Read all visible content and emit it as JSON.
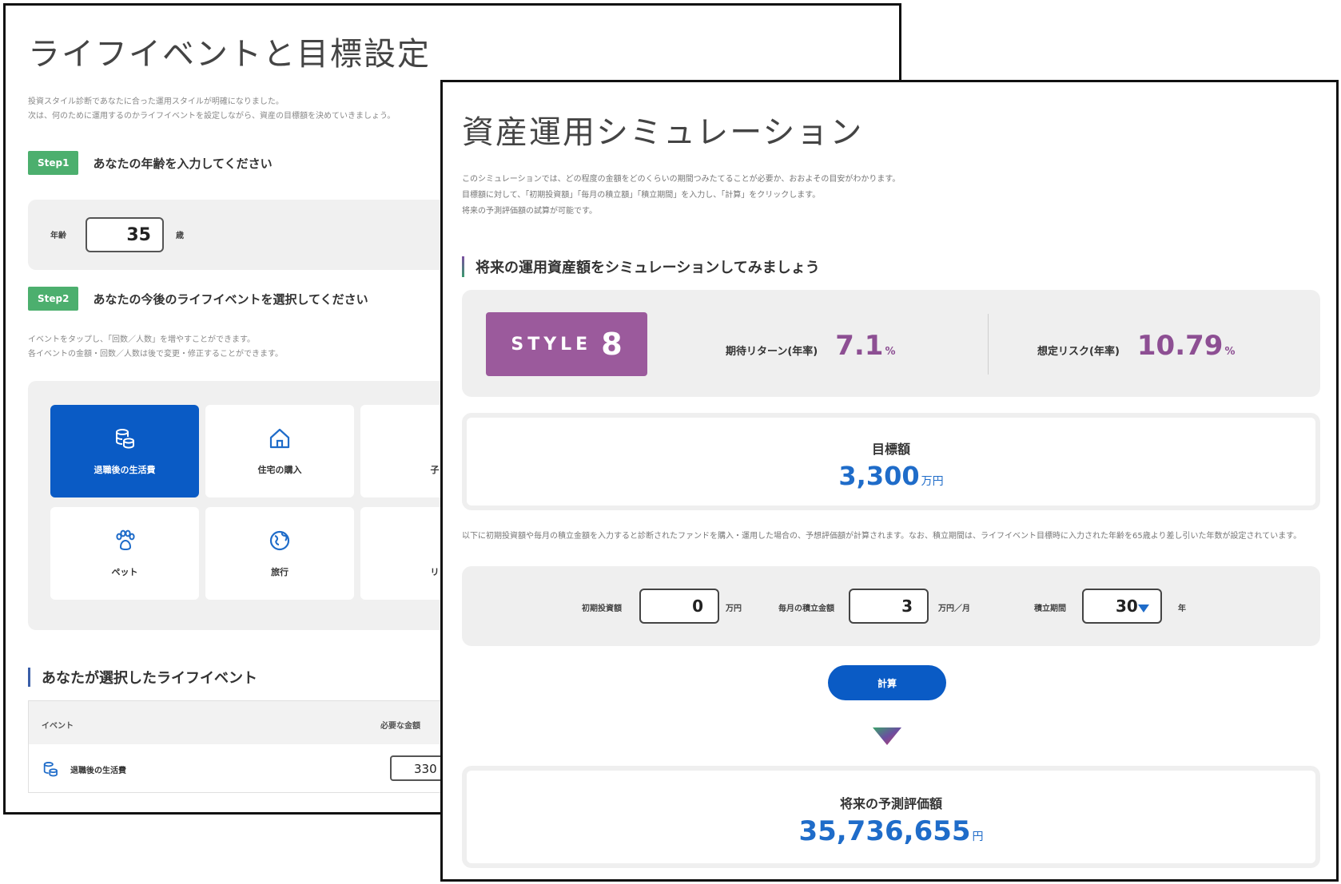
{
  "back": {
    "title": "ライフイベントと目標設定",
    "intro_lines": [
      "投資スタイル診断であなたに合った運用スタイルが明確になりました。",
      "次は、何のために運用するのかライフイベントを設定しながら、資産の目標額を決めていきましょう。"
    ],
    "step1": {
      "badge": "Step1",
      "text": "あなたの年齢を入力してください"
    },
    "age": {
      "label": "年齢",
      "value": "35",
      "unit": "歳"
    },
    "step2": {
      "badge": "Step2",
      "text": "あなたの今後のライフイベントを選択してください",
      "desc_lines": [
        "イベントをタップし、「回数／人数」を増やすことができます。",
        "各イベントの金額・回数／人数は後で変更・修正することができます。"
      ]
    },
    "events": [
      {
        "label": "退職後の生活費",
        "icon": "coins-icon",
        "selected": true
      },
      {
        "label": "住宅の購入",
        "icon": "house-icon",
        "selected": false
      },
      {
        "label": "子",
        "icon": "",
        "selected": false
      },
      {
        "label": "ペット",
        "icon": "paw-icon",
        "selected": false
      },
      {
        "label": "旅行",
        "icon": "globe-icon",
        "selected": false
      },
      {
        "label": "リ",
        "icon": "",
        "selected": false
      }
    ],
    "selected_heading": "あなたが選択したライフイベント",
    "table": {
      "col_event": "イベント",
      "col_amount": "必要な金額",
      "rows": [
        {
          "name": "退職後の生活費",
          "amount": "330"
        }
      ]
    }
  },
  "front": {
    "title": "資産運用シミュレーション",
    "intro_lines": [
      "このシミュレーションでは、どの程度の金額をどのくらいの期間つみたてることが必要か、おおよその目安がわかります。",
      "目標額に対して、「初期投資額」「毎月の積立額」「積立期間」を入力し、「計算」をクリックします。",
      "将来の予測評価額の試算が可能です。"
    ],
    "heading": "将来の運用資産額をシミュレーションしてみましょう",
    "style": {
      "word": "STYLE",
      "number": "8",
      "color": "#9b5a9c"
    },
    "expected_return": {
      "label": "期待リターン(年率)",
      "value": "7.1",
      "unit": "%"
    },
    "assumed_risk": {
      "label": "想定リスク(年率)",
      "value": "10.79",
      "unit": "%"
    },
    "target": {
      "label": "目標額",
      "value": "3,300",
      "unit": "万円"
    },
    "note": "以下に初期投資額や毎月の積立金額を入力すると診断されたファンドを購入・運用した場合の、予想評価額が計算されます。なお、積立期間は、ライフイベント目標時に入力された年齢を65歳より差し引いた年数が設定されています。",
    "inputs": {
      "initial_label": "初期投資額",
      "initial_value": "0",
      "initial_unit": "万円",
      "monthly_label": "毎月の積立金額",
      "monthly_value": "3",
      "monthly_unit": "万円／月",
      "period_label": "積立期間",
      "period_value": "30",
      "period_unit": "年"
    },
    "calc_button": "計算",
    "result": {
      "label": "将来の予測評価額",
      "value": "35,736,655",
      "unit": "円"
    },
    "colors": {
      "accent_blue": "#0a5bc5",
      "value_blue": "#1f6cc9",
      "metric_purple": "#8d4f93",
      "step_green": "#4caf6e"
    }
  }
}
